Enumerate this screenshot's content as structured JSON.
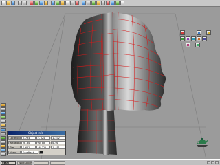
{
  "toolbar": {
    "buttons": [
      {
        "icon": "new-file-icon"
      },
      {
        "icon": "open-folder-icon"
      },
      {
        "icon": "save-icon"
      },
      {
        "icon": "undo-icon"
      },
      {
        "icon": "redo-icon"
      },
      {
        "icon": "select-icon"
      },
      {
        "icon": "move-icon"
      },
      {
        "icon": "rotate-icon"
      },
      {
        "icon": "scale-icon"
      },
      {
        "icon": "sphere-icon"
      },
      {
        "icon": "cube-icon"
      },
      {
        "icon": "cylinder-icon"
      },
      {
        "icon": "light-icon"
      },
      {
        "icon": "camera-icon"
      },
      {
        "icon": "material-icon"
      },
      {
        "icon": "render-icon"
      },
      {
        "icon": "zoom-icon"
      },
      {
        "icon": "pan-icon"
      },
      {
        "icon": "orbit-icon"
      },
      {
        "icon": "grid-icon"
      },
      {
        "icon": "snap-icon"
      },
      {
        "icon": "wireframe-icon"
      },
      {
        "icon": "shaded-icon"
      },
      {
        "icon": "help-icon"
      }
    ]
  },
  "transform_panel": {
    "title": "Object Info",
    "rows": [
      {
        "label": "Location",
        "values": [
          "0.794",
          "2.324",
          "1.572"
        ]
      },
      {
        "label": "Rotation",
        "values": [
          "90.00",
          "90.00",
          "0.00"
        ]
      },
      {
        "label": "Size",
        "values": [
          "7.662",
          "16.322",
          "1.451"
        ]
      },
      {
        "label": "Name",
        "values": [
          "FaceMesh",
          "",
          ""
        ]
      }
    ]
  },
  "palette": {
    "colors": [
      "#d43a3a",
      "#3a7ac4",
      "#d4b02a",
      "#3a9a3a",
      "#8a3ab4",
      "#2a9ab4",
      "#c46a2a",
      "#4a4a9a",
      "#b43a7a",
      "#3ab46a"
    ]
  },
  "taskbar": {
    "start_label": "Start",
    "tasks": [
      "Workspace",
      "",
      ""
    ]
  },
  "colors": {
    "wire": "#d61a1a",
    "background": "#9b9b9b",
    "panel_title": "#0a246a"
  }
}
